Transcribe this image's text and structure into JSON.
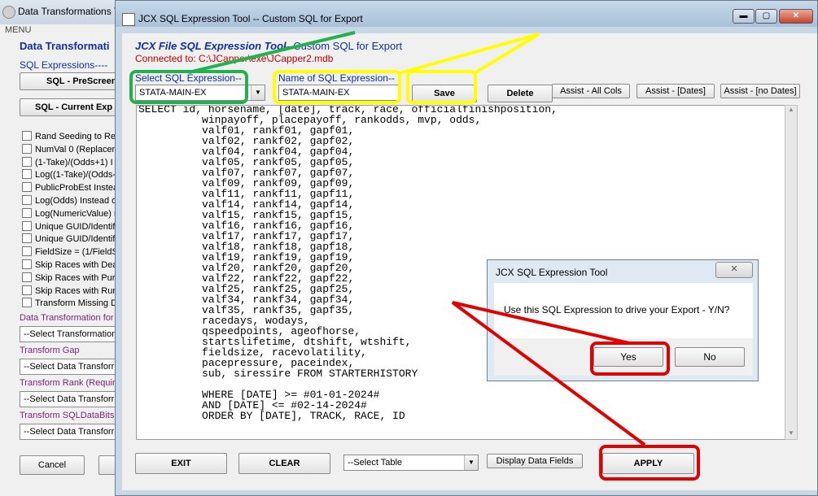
{
  "back_window": {
    "title": "Data Transformations To",
    "menu": "MENU",
    "heading": "Data Transformati",
    "sql_expressions_label": "SQL Expressions----",
    "sql_prescreen_label": "SQL - PreScreen",
    "sql_current_label": "SQL - Current Exp",
    "checkboxes": [
      "Rand Seeding to Red",
      "NumVal 0 (Replaceme",
      "(1-Take)/(Odds+1) I",
      "Log((1-Take)/(Odds-",
      "PublicProbEst Instea",
      "Log(Odds) Instead o",
      "Log(NumericValue) re",
      "Unique GUID/Identifi",
      "Unique GUID/Identifi",
      "FieldSize = (1/FieldS",
      "Skip Races with Dea",
      "Skip Races with Purs",
      "Skip Races with Runn",
      "Transform Missing Da"
    ],
    "transform_formula_label": "Data Transformation for",
    "transform_formula_value": "--Select Transformation",
    "transform_gap_label": "Transform Gap",
    "transform_gap_value": "--Select Data Transforr",
    "transform_rank_label": "Transform Rank (Require",
    "transform_rank_value": "--Select Data Transforr",
    "transform_sqldatabits_label": "Transform SQLDataBits (",
    "transform_sqldatabits_value": "--Select Data Transforr",
    "cancel_label": "Cancel"
  },
  "dialog": {
    "title": "JCX SQL Expression Tool -- Custom SQL for Export",
    "heading": "JCX File SQL Expression Tool",
    "subheading": "-- Custom SQL for Export",
    "connected": "Connected to: C:\\JCapper\\exe\\JCapper2.mdb",
    "select_label": "Select SQL Expression--",
    "select_value": "STATA-MAIN-EX",
    "name_label": "Name of SQL Expression--",
    "name_value": "STATA-MAIN-EX",
    "save_label": "Save",
    "delete_label": "Delete",
    "assist_all_label": "Assist - All Cols",
    "assist_dates_label": "Assist - [Dates]",
    "assist_nodates_label": "Assist - [no Dates]",
    "sql_text": "SELECT id, horsename, [date], track, race, officialfinishposition,\n          winpayoff, placepayoff, rankodds, mvp, odds,\n          valf01, rankf01, gapf01,\n          valf02, rankf02, gapf02,\n          valf04, rankf04, gapf04,\n          valf05, rankf05, gapf05,\n          valf07, rankf07, gapf07,\n          valf09, rankf09, gapf09,\n          valf11, rankf11, gapf11,\n          valf14, rankf14, gapf14,\n          valf15, rankf15, gapf15,\n          valf16, rankf16, gapf16,\n          valf17, rankf17, gapf17,\n          valf18, rankf18, gapf18,\n          valf19, rankf19, gapf19,\n          valf20, rankf20, gapf20,\n          valf22, rankf22, gapf22,\n          valf25, rankf25, gapf25,\n          valf34, rankf34, gapf34,\n          valf35, rankf35, gapf35,\n          racedays, wodays,\n          qspeedpoints, ageofhorse,\n          startslifetime, dtshift, wtshift,\n          fieldsize, racevolatility,\n          pacepressure, paceindex,\n          sub, siressire FROM STARTERHISTORY\n\n          WHERE [DATE] >= #01-01-2024#\n          AND [DATE] <= #02-14-2024#\n          ORDER BY [DATE], TRACK, RACE, ID",
    "exit_label": "EXIT",
    "clear_label": "CLEAR",
    "table_select_value": "--Select Table",
    "display_fields_label": "Display Data Fields",
    "apply_label": "APPLY"
  },
  "confirm": {
    "title": "JCX SQL Expression Tool",
    "close_glyph": "✕",
    "message": "Use this SQL Expression to drive your Export - Y/N?",
    "yes_label": "Yes",
    "no_label": "No"
  },
  "window_controls": {
    "minimize": "▬",
    "maximize": "▢",
    "close": "✕"
  },
  "annotation_colors": {
    "green": "#22b14c",
    "yellow": "#ffff00",
    "red": "#e00000"
  }
}
